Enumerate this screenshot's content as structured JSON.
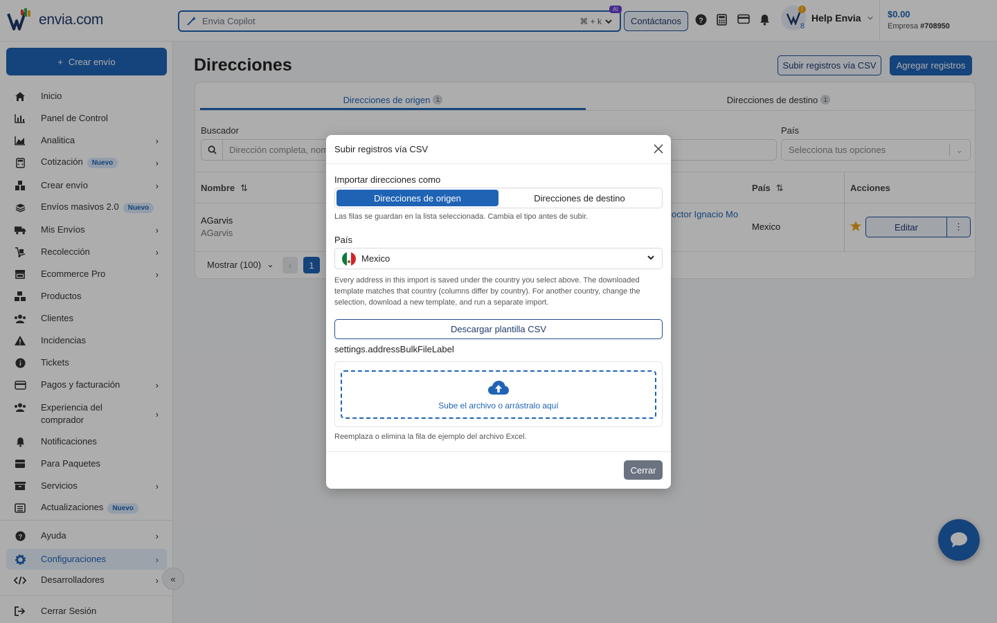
{
  "header": {
    "logo_text": "envia.com",
    "search_placeholder": "Envia Copilot",
    "search_shortcut": "⌘ + k",
    "ai_badge": "AI",
    "contact_label": "Contáctanos",
    "user_name": "Help Envia",
    "notification_count": "8",
    "alert_count": "!",
    "balance": "$0.00",
    "company_label": "Empresa",
    "company_id": "#708950"
  },
  "sidebar": {
    "create_label": "Crear envío",
    "new_badge": "Nuevo",
    "items": [
      {
        "label": "Inicio"
      },
      {
        "label": "Panel de Control"
      },
      {
        "label": "Analitica"
      },
      {
        "label": "Cotización"
      },
      {
        "label": "Crear envío"
      },
      {
        "label": "Envíos masivos 2.0"
      },
      {
        "label": "Mis Envíos"
      },
      {
        "label": "Recolección"
      },
      {
        "label": "Ecommerce Pro"
      },
      {
        "label": "Productos"
      },
      {
        "label": "Clientes"
      },
      {
        "label": "Incidencias"
      },
      {
        "label": "Tickets"
      },
      {
        "label": "Pagos y facturación"
      },
      {
        "label": "Experiencia del comprador"
      },
      {
        "label": "Notificaciones"
      },
      {
        "label": "Para Paquetes"
      },
      {
        "label": "Servicios"
      },
      {
        "label": "Actualizaciones"
      },
      {
        "label": "Ayuda"
      },
      {
        "label": "Configuraciones"
      },
      {
        "label": "Desarrolladores"
      },
      {
        "label": "Cerrar Sesión"
      }
    ]
  },
  "main": {
    "title": "Direcciones",
    "upload_csv_label": "Subir registros vía CSV",
    "add_records_label": "Agregar registros",
    "tabs": [
      {
        "label": "Direcciones de origen",
        "count": "1"
      },
      {
        "label": "Direcciones de destino",
        "count": "1"
      }
    ],
    "search_label": "Buscador",
    "search_placeholder": "Dirección completa, nom",
    "country_label": "País",
    "country_placeholder": "Selecciona tus opciones",
    "columns": {
      "name": "Nombre",
      "country": "País",
      "actions": "Acciones"
    },
    "row": {
      "name": "AGarvis",
      "subname": "AGarvis",
      "address": "octor Ignacio Mo",
      "country": "Mexico",
      "edit": "Editar"
    },
    "show_label": "Mostrar (100)",
    "page": "1"
  },
  "modal": {
    "title": "Subir registros vía CSV",
    "import_label": "Importar direcciones como",
    "seg_origin": "Direcciones de origen",
    "seg_dest": "Direcciones de destino",
    "seg_help": "Las filas se guardan en la lista seleccionada. Cambia el tipo antes de subir.",
    "country_label": "País",
    "country_value": "Mexico",
    "country_help": "Every address in this import is saved under the country you select above. The downloaded template matches that country (columns differ by country). For another country, change the selection, download a new template, and run a separate import.",
    "download_label": "Descargar plantilla CSV",
    "file_label": "settings.addressBulkFileLabel",
    "drop_text": "Sube el archivo o arrástralo aquí",
    "file_help": "Reemplaza o elimina la fila de ejemplo del archivo Excel.",
    "close_label": "Cerrar"
  },
  "colors": {
    "primary": "#1f63b5",
    "badge_ai": "#6a3fd1",
    "star": "#f0a41c"
  }
}
